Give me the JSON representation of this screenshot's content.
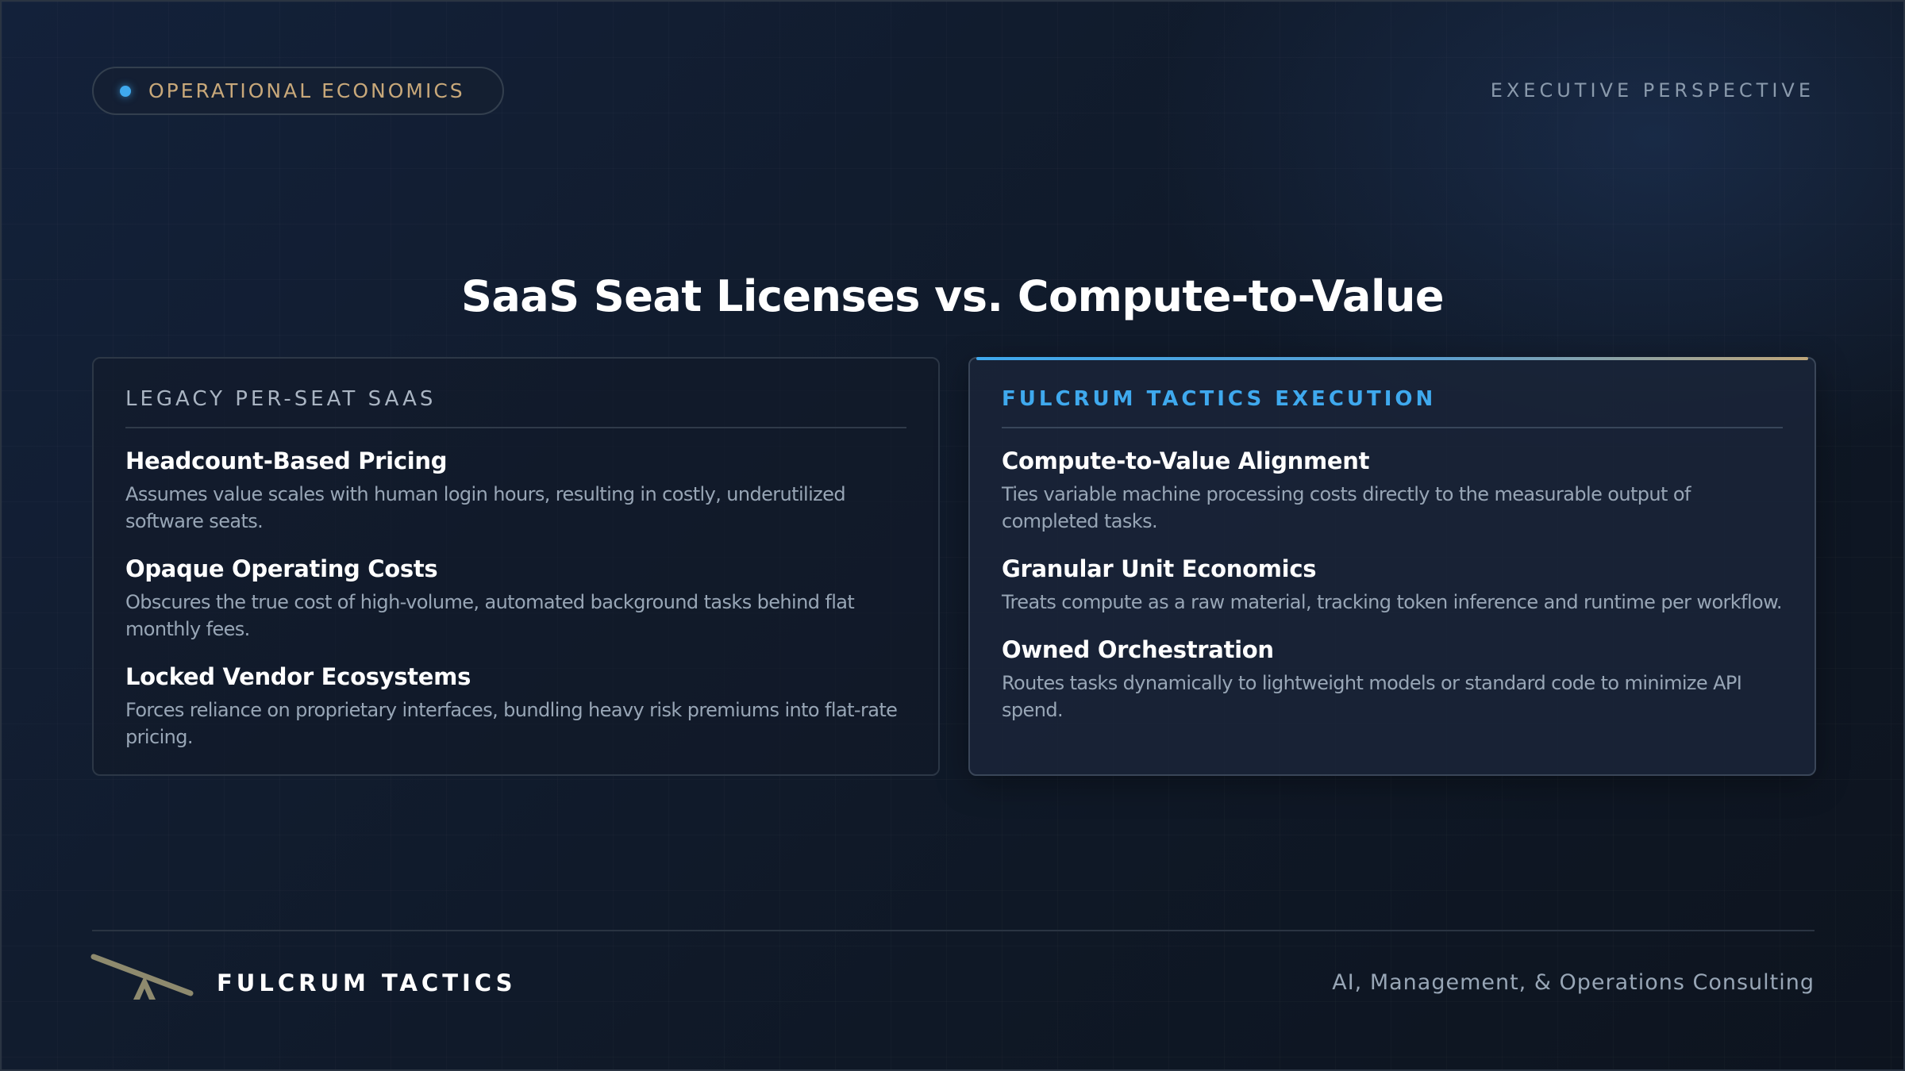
{
  "header": {
    "category_label": "OPERATIONAL ECONOMICS",
    "perspective_label": "EXECUTIVE PERSPECTIVE"
  },
  "title": "SaaS Seat Licenses vs. Compute-to-Value",
  "left_card": {
    "heading": "LEGACY PER-SEAT SAAS",
    "items": [
      {
        "title": "Headcount-Based Pricing",
        "description": "Assumes value scales with human login hours, resulting in costly, underutilized software seats."
      },
      {
        "title": "Opaque Operating Costs",
        "description": "Obscures the true cost of high-volume, automated background tasks behind flat monthly fees."
      },
      {
        "title": "Locked Vendor Ecosystems",
        "description": "Forces reliance on proprietary interfaces, bundling heavy risk premiums into flat-rate pricing."
      }
    ]
  },
  "right_card": {
    "heading": "FULCRUM TACTICS EXECUTION",
    "items": [
      {
        "title": "Compute-to-Value Alignment",
        "description": "Ties variable machine processing costs directly to the measurable output of completed tasks."
      },
      {
        "title": "Granular Unit Economics",
        "description": "Treats compute as a raw material, tracking token inference and runtime per workflow."
      },
      {
        "title": "Owned Orchestration",
        "description": "Routes tasks dynamically to lightweight models or standard code to minimize API spend."
      }
    ]
  },
  "footer": {
    "brand": "FULCRUM TACTICS",
    "tagline": "AI, Management, & Operations Consulting",
    "logo_icon": "fulcrum-seesaw-icon"
  },
  "colors": {
    "accent_blue": "#3fa9ee",
    "accent_gold": "#c8a87a",
    "logo_olive": "#8e8a6e"
  }
}
